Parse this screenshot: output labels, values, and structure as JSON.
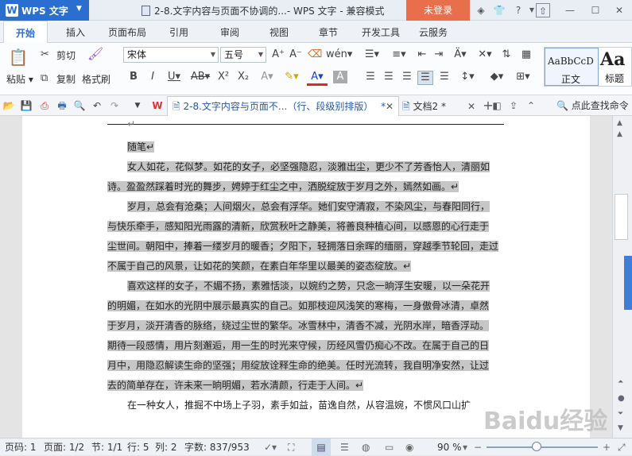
{
  "titlebar": {
    "app_name": "WPS 文字",
    "title": "2-8.文字内容与页面不协调的...- WPS 文字 - 兼容模式",
    "login_label": "未登录"
  },
  "menu": {
    "tabs": [
      "开始",
      "插入",
      "页面布局",
      "引用",
      "审阅",
      "视图",
      "章节",
      "开发工具",
      "云服务"
    ],
    "active": "开始"
  },
  "ribbon": {
    "paste": "粘贴",
    "cut": "剪切",
    "copy": "复制",
    "format_painter": "格式刷",
    "font_name": "宋体",
    "font_size": "五号",
    "style_sample": "AaBbCcD",
    "style_normal": "正文",
    "style_big_sample": "Aa",
    "style_heading": "标题"
  },
  "quickbar": {
    "tab1": "2-8.文字内容与页面不...（行、段级别排版）",
    "tab1_mod": "*",
    "tab2": "文档2",
    "tab2_mod": "*",
    "search": "点此查找命令"
  },
  "document": {
    "paragraph_mark": "↵",
    "lines": [
      "随笔↵",
      "女人如花，花似梦。如花的女子，必坚强隐忍，淡雅出尘，更少不了芳香怡人，清丽如",
      "诗。盈盈然踩着时光的舞步，娉婷于红尘之中，洒脱绽放于岁月之外，嫣然如画。↵",
      "岁月，总会有沧桑；人间烟火，总会有浮华。她们安守清寂，不染风尘，与春阳同行，",
      "与快乐牵手，感知阳光雨露的清新，欣赏秋叶之静美，将善良种植心间，以感恩的心行走于",
      "尘世间。朝阳中，捧着一缕岁月的暖香；夕阳下，轻拥落日余晖的缅丽，穿越季节轮回，走过",
      "不属于自己的风景，让如花的笑颜，在素白年华里以最美的姿态绽放。↵",
      "喜欢这样的女子，不媚不扬，素雅恬淡，以婉约之势，只念一晌浮生安暖，以一朵花开",
      "的明媚，在如水的光阴中展示最真实的自己。如那枝迎风浅笑的寒梅，一身傲骨冰清，卓然",
      "于岁月，淡开清香的脉络，绕过尘世的繁华。冰雪林中，清香不减，光阴水岸，暗香浮动。",
      "期待一段感情，用片刻邂逅，用一生的时光来守候，历经风雪仍痴心不改。在属于自己的日",
      "月中，用隐忍解读生命的坚强；用绽放诠释生命的绝美。任时光流转，我自明净安然，让过",
      "去的简单存在，许未来一晌明媚，若水清颜，行走于人间。↵",
      "在一种女人，推掘不中场上子羽，素手如益，苗逸自然，从容温婉，不惯风口山扩"
    ]
  },
  "status": {
    "page_code": "页码: 1",
    "pages": "页面: 1/2",
    "section": "节: 1/1",
    "row": "行: 5",
    "col": "列: 2",
    "wordcount": "字数: 837/953",
    "zoom": "90 %",
    "zoom_fraction": 0.45
  },
  "watermark": "Baidu经验"
}
